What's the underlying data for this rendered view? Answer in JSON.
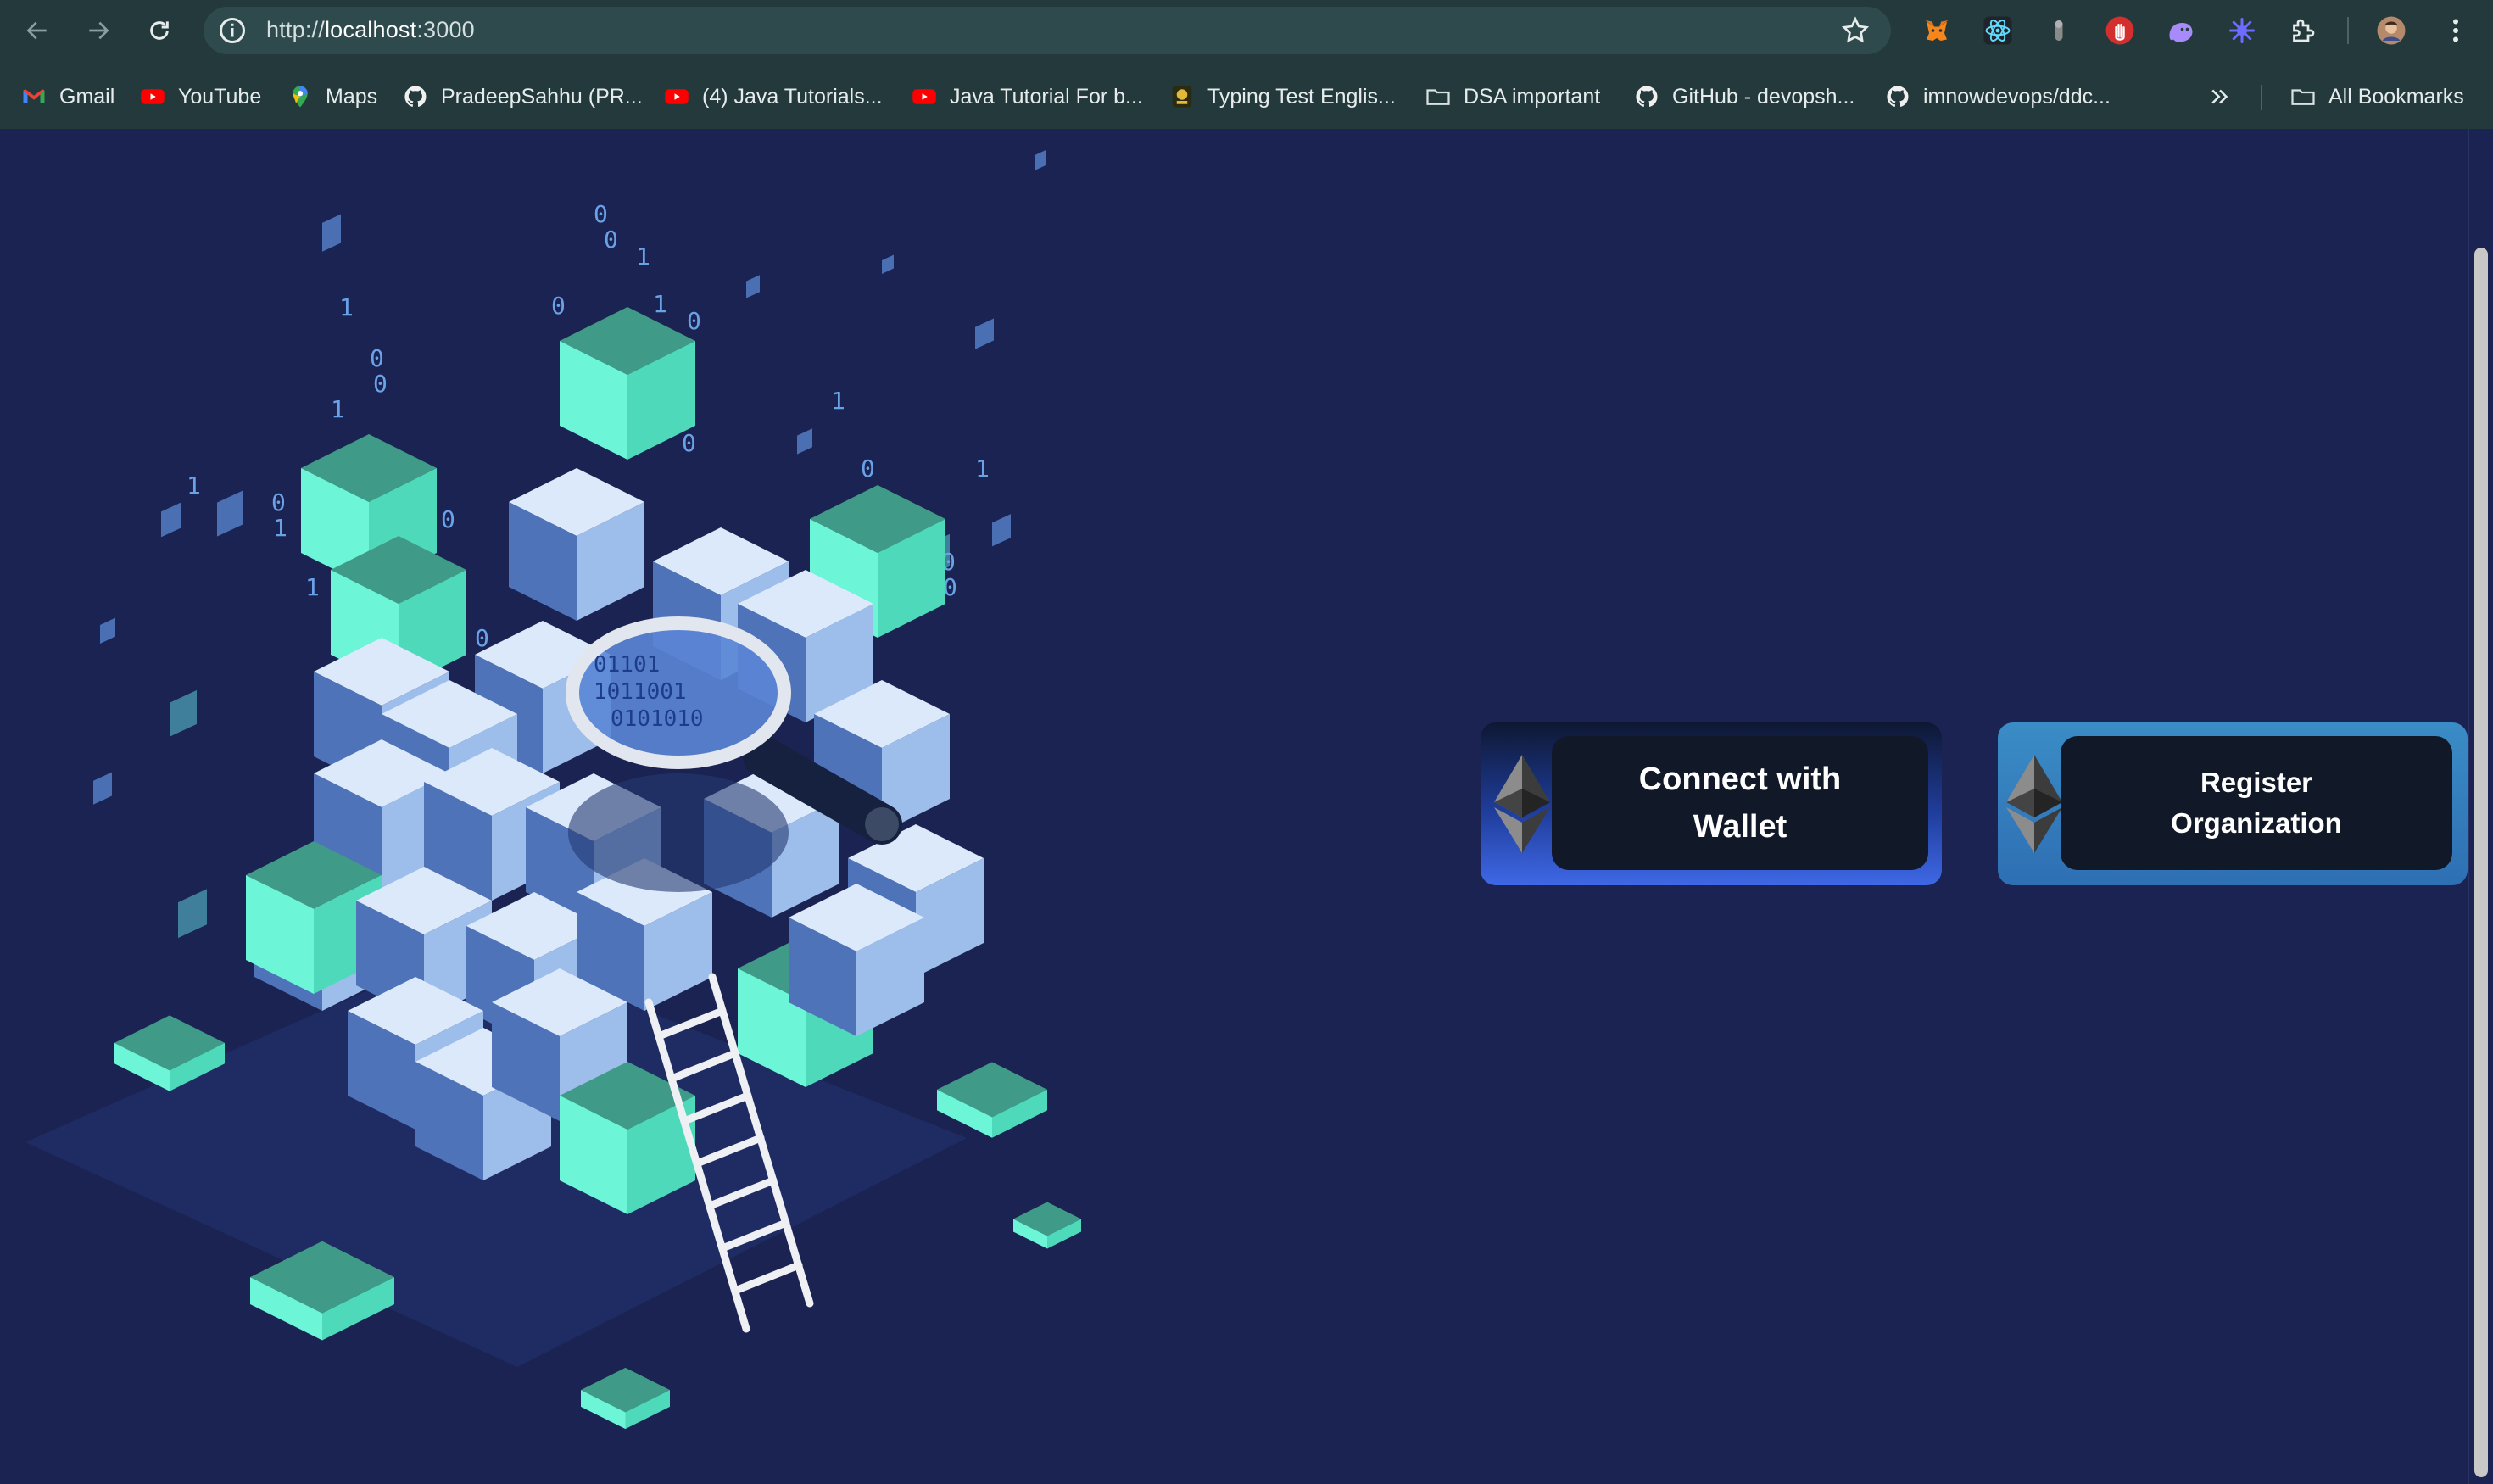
{
  "browser": {
    "url_scheme": "http://",
    "url_host": "localhost",
    "url_port": ":3000",
    "bookmarks": [
      {
        "label": "Gmail",
        "icon": "gmail-icon"
      },
      {
        "label": "YouTube",
        "icon": "youtube-icon"
      },
      {
        "label": "Maps",
        "icon": "maps-icon"
      },
      {
        "label": "PradeepSahhu (PR...",
        "icon": "github-icon"
      },
      {
        "label": "(4) Java Tutorials...",
        "icon": "youtube-icon"
      },
      {
        "label": "Java Tutorial For b...",
        "icon": "youtube-icon"
      },
      {
        "label": "Typing Test Englis...",
        "icon": "typing-site-icon"
      },
      {
        "label": "DSA important",
        "icon": "folder-icon"
      },
      {
        "label": "GitHub - devopsh...",
        "icon": "github-icon"
      },
      {
        "label": "imnowdevops/ddc...",
        "icon": "github-icon"
      }
    ],
    "all_bookmarks_label": "All Bookmarks",
    "extensions": [
      "metamask-fox-icon",
      "react-devtools-icon",
      "extension-gray-icon",
      "hand-stop-icon",
      "ghost-extension-icon",
      "redux-devtools-icon",
      "puzzle-extensions-icon"
    ]
  },
  "main": {
    "connect": {
      "line1": "Connect with",
      "line2": "Wallet"
    },
    "register": {
      "line1": "Register",
      "line2": "Organization"
    }
  },
  "colors": {
    "page_background": "#1b2352",
    "chrome_background": "#23393b",
    "cube_teal": "#64f0d2",
    "cube_blue": "#9ec2f0",
    "button_dark": "#111827",
    "connect_gradient_end": "#3f68e6",
    "register_background": "#3a8cc6"
  }
}
